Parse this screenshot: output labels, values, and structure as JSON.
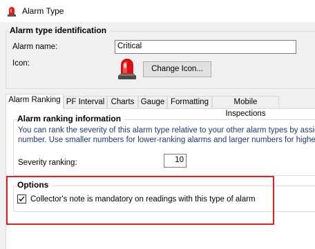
{
  "window": {
    "title": "Alarm Type",
    "icon": "alarm-beacon-icon"
  },
  "identification": {
    "group_title": "Alarm type identification",
    "name_label": "Alarm name:",
    "name_value": "Critical",
    "icon_label": "Icon:",
    "icon_name": "red-alarm-beacon-icon",
    "change_icon_label": "Change Icon..."
  },
  "tabs": [
    {
      "label": "Alarm Ranking",
      "active": true
    },
    {
      "label": "PF Interval"
    },
    {
      "label": "Charts"
    },
    {
      "label": "Gauge"
    },
    {
      "label": "Formatting"
    },
    {
      "label": "Mobile Inspections"
    }
  ],
  "ranking": {
    "group_title": "Alarm ranking information",
    "description_line1": "You can rank the severity of this alarm type relative to your other alarm types by assignin",
    "description_line2": "number.  Use smaller numbers for lower-ranking alarms and larger numbers for higher-ran",
    "severity_label": "Severity ranking:",
    "severity_value": "10"
  },
  "options": {
    "group_title": "Options",
    "checkbox_label": "Collector's note is mandatory on readings with this type of alarm",
    "checked": true
  },
  "colors": {
    "highlight": "#e02020",
    "beacon": "#e02020"
  }
}
